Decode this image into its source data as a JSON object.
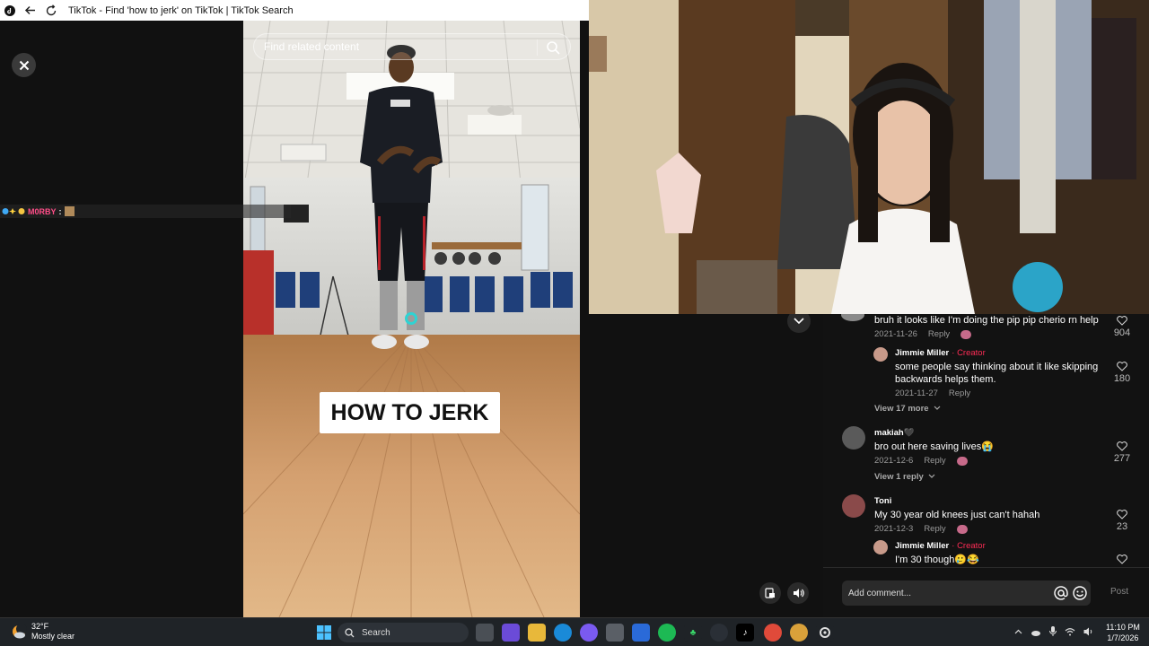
{
  "browser": {
    "title": "TikTok - Find 'how to jerk' on TikTok | TikTok Search"
  },
  "chat": {
    "username": "M0RBY",
    "separator": ":"
  },
  "video": {
    "search_placeholder": "Find related content",
    "caption": "HOW TO JERK"
  },
  "comments": [
    {
      "text": "bruh it looks like I'm doing the pip pip cherio rn help",
      "date": "2021-11-26",
      "reply_label": "Reply",
      "likes": "904"
    },
    {
      "name": "Jimmie Miller",
      "creator_label": "· Creator",
      "text": "some people say thinking about it like skipping backwards helps them.",
      "date": "2021-11-27",
      "reply_label": "Reply",
      "likes": "180"
    },
    {
      "name": "makiah",
      "name_suffix": "🖤",
      "text": "bro out here saving lives😭",
      "date": "2021-12-6",
      "reply_label": "Reply",
      "likes": "277"
    },
    {
      "name": "Toni",
      "text": "My 30 year old knees just can't hahah",
      "date": "2021-12-3",
      "reply_label": "Reply",
      "likes": "23"
    },
    {
      "name": "Jimmie Miller",
      "creator_label": "· Creator",
      "text": "I'm 30 though🥲😂"
    }
  ],
  "view_more": {
    "first": "View 17 more",
    "second": "View 1 reply"
  },
  "comment_box": {
    "placeholder": "Add comment...",
    "post_label": "Post"
  },
  "taskbar": {
    "weather_temp": "32°F",
    "weather_desc": "Mostly clear",
    "search_label": "Search",
    "time": "11:10 PM",
    "date": "1/7/2026"
  },
  "colors": {
    "accent_creator": "#fe2c55",
    "panel_bg": "#121212",
    "cursor_ring": "#2ed3d3"
  }
}
